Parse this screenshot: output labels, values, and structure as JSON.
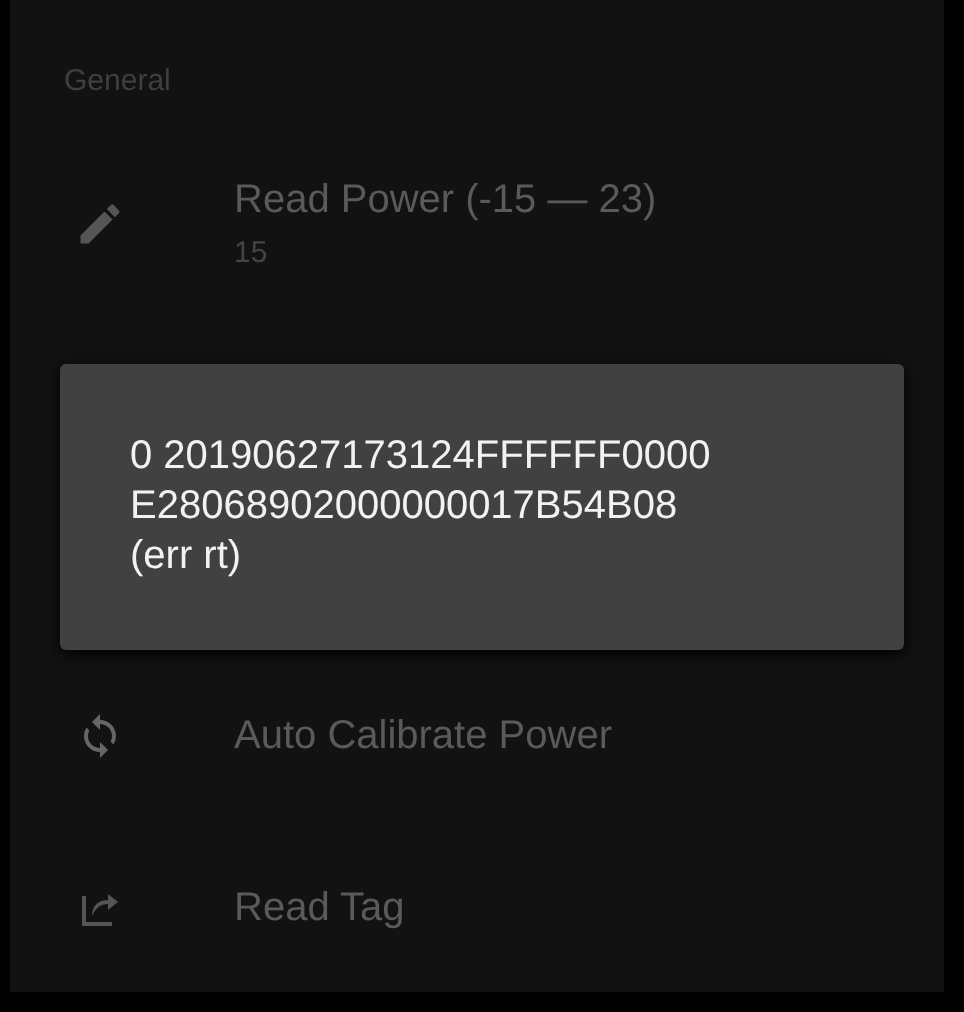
{
  "section": {
    "title": "General"
  },
  "items": [
    {
      "title": "Read Power (-15 — 23)",
      "summary": "15"
    }
  ],
  "toast": {
    "lines": [
      "0 20190627173124FFFFFF0000",
      "E28068902000000017B54B08",
      "(err rt)"
    ]
  },
  "items_below": [
    {
      "title": "Auto Calibrate Power"
    },
    {
      "title": "Read Tag"
    }
  ]
}
